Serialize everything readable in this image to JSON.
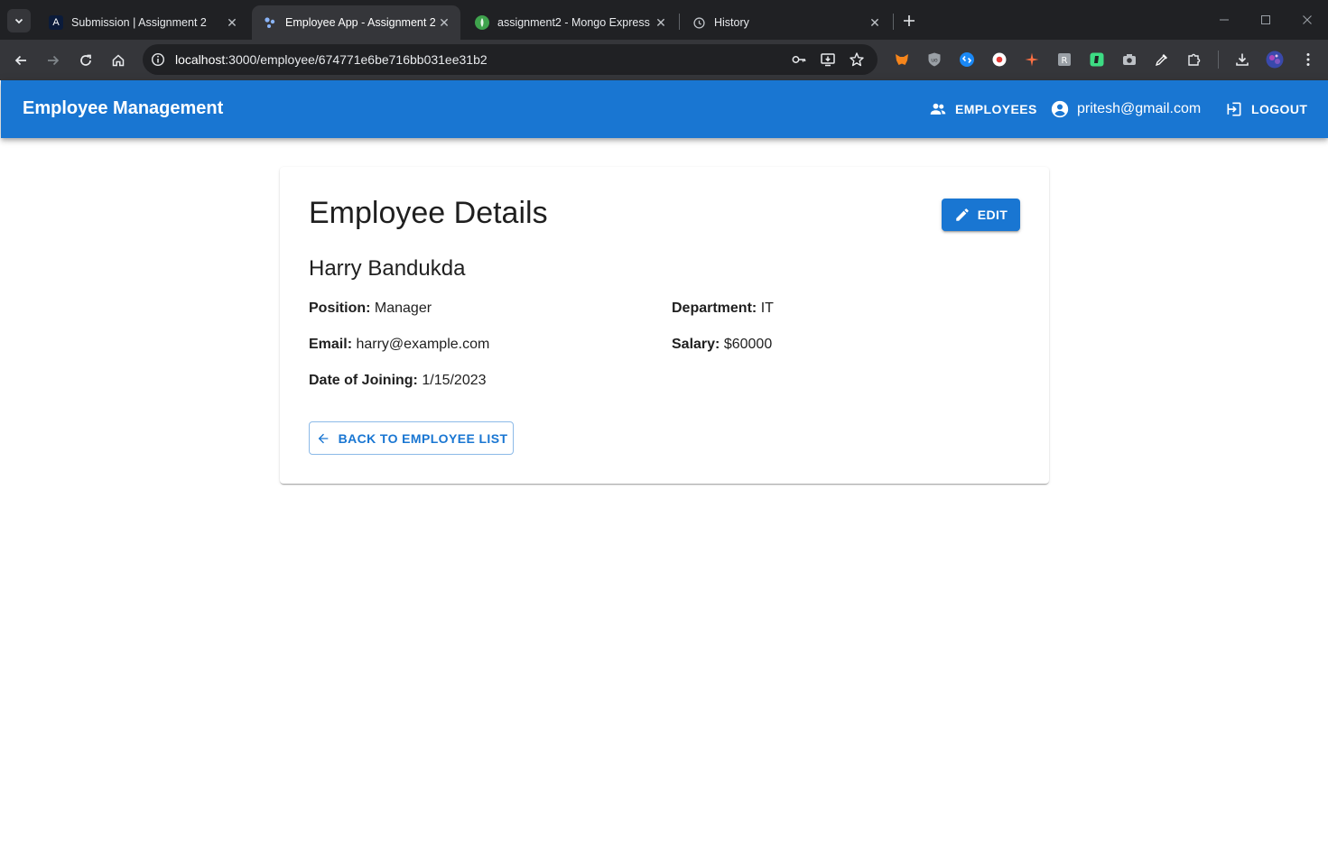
{
  "browser": {
    "tabs": [
      {
        "title": "Submission | Assignment 2",
        "favicon": "letter-a-icon",
        "active": false
      },
      {
        "title": "Employee App - Assignment 2",
        "favicon": "app-icon",
        "active": true
      },
      {
        "title": "assignment2 - Mongo Express",
        "favicon": "mongo-leaf-icon",
        "active": false
      },
      {
        "title": "History",
        "favicon": "history-icon",
        "active": false
      }
    ],
    "url": {
      "host": "localhost",
      "path": ":3000/employee/674771e6be716bb031ee31b2"
    },
    "favicon_letter": "A"
  },
  "app": {
    "brand": "Employee Management",
    "nav": {
      "employees_label": "EMPLOYEES",
      "user_email": "pritesh@gmail.com",
      "logout_label": "LOGOUT"
    },
    "colors": {
      "primary": "#1976d2"
    }
  },
  "details": {
    "title": "Employee Details",
    "edit_label": "EDIT",
    "name": "Harry Bandukda",
    "fields": {
      "position": {
        "label": "Position:",
        "value": "Manager"
      },
      "department": {
        "label": "Department:",
        "value": "IT"
      },
      "email": {
        "label": "Email:",
        "value": "harry@example.com"
      },
      "salary": {
        "label": "Salary:",
        "value": "$60000"
      },
      "date_of_joining": {
        "label": "Date of Joining:",
        "value": "1/15/2023"
      }
    },
    "back_label": "BACK TO EMPLOYEE LIST"
  }
}
